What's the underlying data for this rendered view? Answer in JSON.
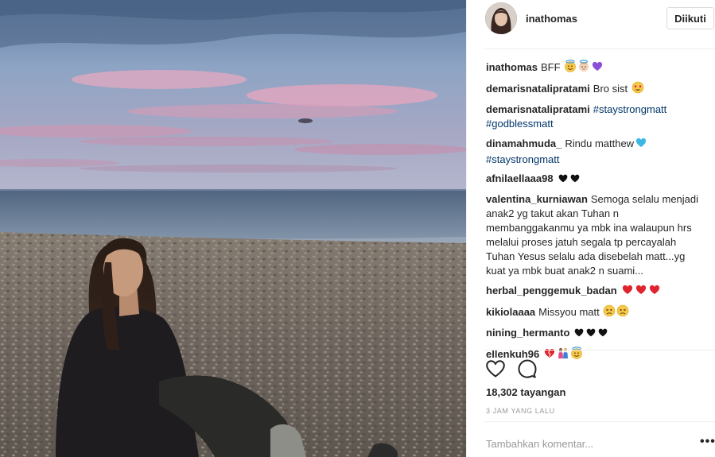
{
  "post": {
    "username": "inathomas",
    "follow_label": "Diikuti",
    "views": "18,302 tayangan",
    "time_ago": "3 JAM YANG LALU",
    "comment_placeholder": "Tambahkan komentar...",
    "more_label": "•••"
  },
  "comments": [
    {
      "user": "inathomas",
      "text": "BFF",
      "emoji": [
        "smiling-face-with-halo",
        "angel-baby",
        "purple-heart"
      ]
    },
    {
      "user": "demarisnatalipratami",
      "text": "Bro sist",
      "emoji": [
        "heart-eyes"
      ]
    },
    {
      "user": "demarisnatalipratami",
      "tag1": "#staystrongmatt",
      "tag2": "#godblessmatt"
    },
    {
      "user": "dinamahmuda_",
      "text": "Rindu matthew",
      "tag": "#staystrongmatt",
      "emoji": [
        "blue-heart"
      ]
    },
    {
      "user": "afnilaellaaa98",
      "text": "",
      "emoji": [
        "black-heart",
        "black-heart"
      ]
    },
    {
      "user": "valentina_kurniawan",
      "text": "Semoga selalu menjadi anak2 yg takut akan Tuhan n membanggakanmu ya mbk ina walaupun hrs melalui proses jatuh segala tp percayalah Tuhan Yesus selalu ada disebelah matt...yg kuat ya mbk buat anak2 n suami..."
    },
    {
      "user": "herbal_penggemuk_badan",
      "text": "",
      "emoji": [
        "red-heart",
        "red-heart",
        "red-heart"
      ]
    },
    {
      "user": "kikiolaaaa",
      "text": "Missyou matt",
      "emoji": [
        "persevering-face",
        "persevering-face"
      ]
    },
    {
      "user": "nining_hermanto",
      "text": "",
      "emoji": [
        "black-heart",
        "black-heart",
        "black-heart"
      ]
    },
    {
      "user": "ellenkuh96",
      "text": "",
      "emoji": [
        "broken-heart",
        "couple",
        "smiling-face-with-halo"
      ]
    }
  ],
  "icons": {
    "like": "heart-outline-icon",
    "comment": "speech-bubble-icon",
    "more": "ellipsis-icon"
  },
  "colors": {
    "hashtag": "#003569",
    "text": "#262626",
    "muted": "#999999",
    "divider": "#efefef"
  }
}
